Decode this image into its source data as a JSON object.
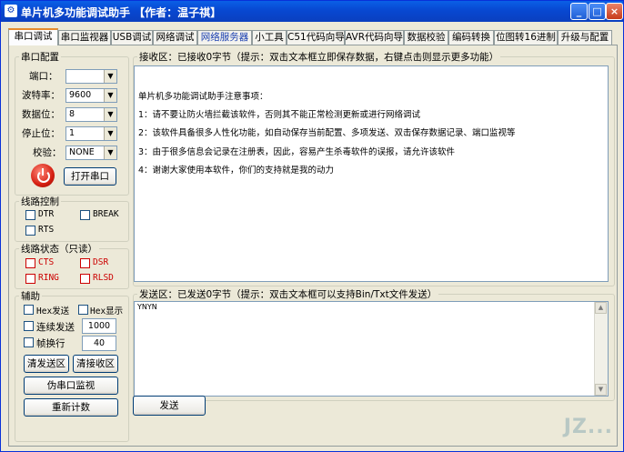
{
  "window": {
    "title": "单片机多功能调试助手 【作者：温子祺】",
    "minimize": "_",
    "maximize": "□",
    "close": "×"
  },
  "tabs": [
    {
      "label": "串口调试"
    },
    {
      "label": "串口监视器"
    },
    {
      "label": "USB调试"
    },
    {
      "label": "网络调试"
    },
    {
      "label": "网络服务器"
    },
    {
      "label": "小工具"
    },
    {
      "label": "C51代码向导"
    },
    {
      "label": "AVR代码向导"
    },
    {
      "label": "数据校验"
    },
    {
      "label": "编码转换"
    },
    {
      "label": "位图转16进制"
    },
    {
      "label": "升级与配置"
    }
  ],
  "serial_config": {
    "legend": "串口配置",
    "port_label": "端口：",
    "port_value": "",
    "baud_label": "波特率：",
    "baud_value": "9600",
    "databits_label": "数据位：",
    "databits_value": "8",
    "stopbits_label": "停止位：",
    "stopbits_value": "1",
    "parity_label": "校验：",
    "parity_value": "NONE",
    "open_button": "打开串口"
  },
  "line_control": {
    "legend": "线路控制",
    "dtr": "DTR",
    "break": "BREAK",
    "rts": "RTS"
  },
  "line_status": {
    "legend": "线路状态（只读）",
    "cts": "CTS",
    "dsr": "DSR",
    "ring": "RING",
    "rlsd": "RLSD"
  },
  "assist": {
    "legend": "辅助",
    "hex_send": "Hex发送",
    "hex_show": "Hex显示",
    "continuous_send": "连续发送",
    "interval_value": "1000",
    "frame_newline": "帧换行",
    "frame_value": "40",
    "clear_send": "清发送区",
    "clear_recv": "清接收区",
    "fake_monitor": "伪串口监视",
    "recount": "重新计数"
  },
  "receive": {
    "legend": "接收区：已接收0字节（提示：双击文本框立即保存数据，右键点击则显示更多功能）",
    "heading": "单片机多功能调试助手注意事项：",
    "lines": [
      "1：请不要让防火墙拦截该软件，否则其不能正常检测更新或进行网络调试",
      "2：该软件具备很多人性化功能，如自动保存当前配置、多项发送、双击保存数据记录、端口监视等",
      "3：由于很多信息会记录在注册表，因此，容易产生杀毒软件的误报，请允许该软件",
      "4：谢谢大家使用本软件，你们的支持就是我的动力"
    ]
  },
  "send": {
    "legend": "发送区：已发送0字节（提示：双击文本框可以支持Bin/Txt文件发送）",
    "content": "YNYN",
    "send_button": "发送"
  },
  "watermark": "JZ..."
}
